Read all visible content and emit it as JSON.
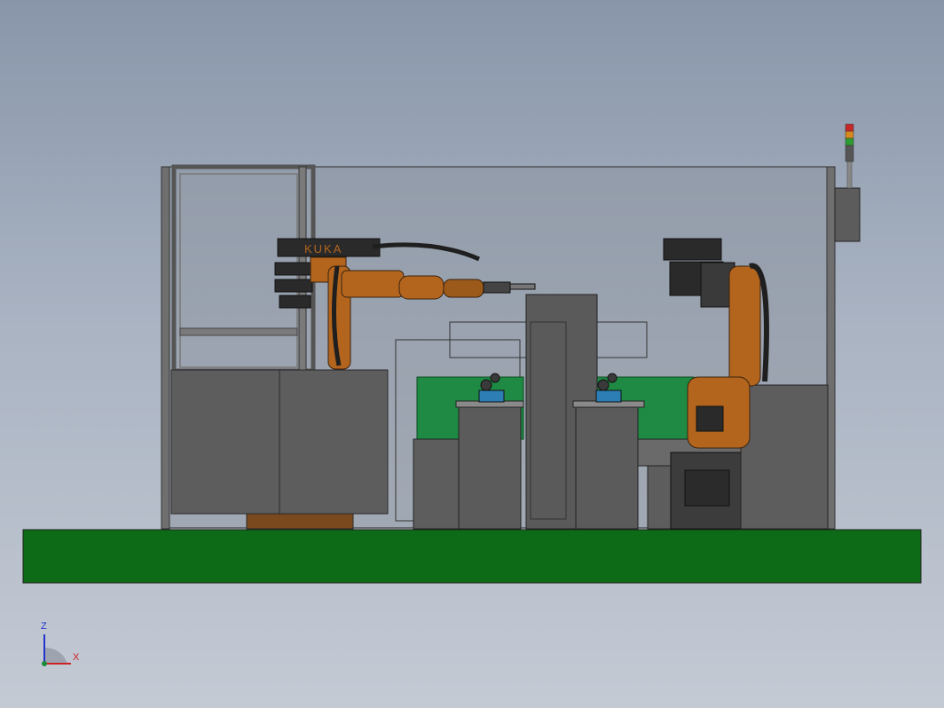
{
  "scene": {
    "robot_brand_label": "KUKA",
    "axis_z_label": "Z",
    "axis_x_label": "X",
    "colors": {
      "background_top": "#8996aa",
      "background_bottom": "#c4cad4",
      "base_platform": "#0d6a16",
      "frame_gray": "#6f6f6f",
      "enclosure_glass": "#8e95a1",
      "machine_gray": "#5d5d5d",
      "robot_orange": "#b3651d",
      "fixture_green": "#1e8a43",
      "cable_black": "#1f1f1f",
      "axis_z_color": "#2233cc",
      "axis_x_color": "#cc2222"
    },
    "icons": [
      "signal-tower-icon",
      "coordinate-triad-icon"
    ]
  }
}
